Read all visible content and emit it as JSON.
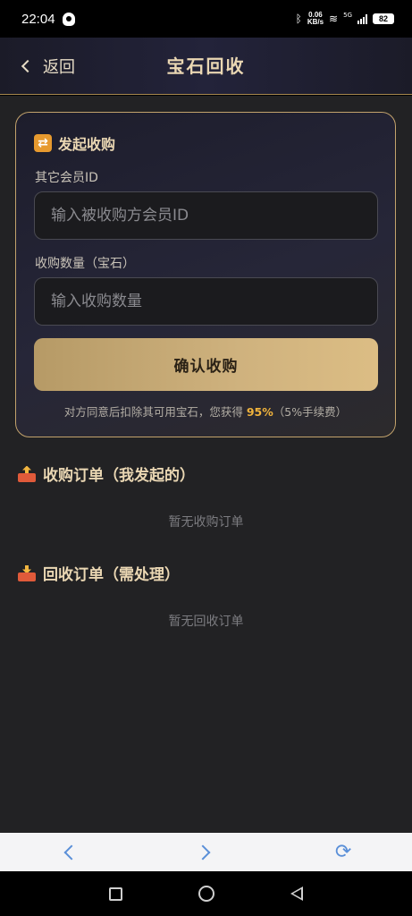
{
  "status_bar": {
    "time": "22:04",
    "net_speed_value": "0.06",
    "net_speed_unit": "KB/s",
    "network": "5G",
    "battery": "82"
  },
  "header": {
    "back_label": "返回",
    "title": "宝石回收"
  },
  "purchase_form": {
    "title": "发起收购",
    "member_id_label": "其它会员ID",
    "member_id_placeholder": "输入被收购方会员ID",
    "member_id_value": "",
    "quantity_label": "收购数量（宝石）",
    "quantity_placeholder": "输入收购数量",
    "quantity_value": "",
    "confirm_label": "确认收购",
    "note_prefix": "对方同意后扣除其可用宝石，您获得 ",
    "note_highlight": "95%",
    "note_suffix": "（5%手续费）"
  },
  "purchase_orders": {
    "title": "收购订单（我发起的）",
    "empty_text": "暂无收购订单"
  },
  "recycle_orders": {
    "title": "回收订单（需处理）",
    "empty_text": "暂无回收订单"
  },
  "browser_nav": {
    "back_icon": "chevron-left-icon",
    "forward_icon": "chevron-right-icon",
    "refresh_icon": "refresh-icon"
  },
  "colors": {
    "accent_gold": "#ead7b3",
    "button_gold": "#cfb27e",
    "highlight": "#f0b33c",
    "card_border": "#c3a36c",
    "background": "#222224",
    "browser_icon": "#5a8fd8"
  }
}
